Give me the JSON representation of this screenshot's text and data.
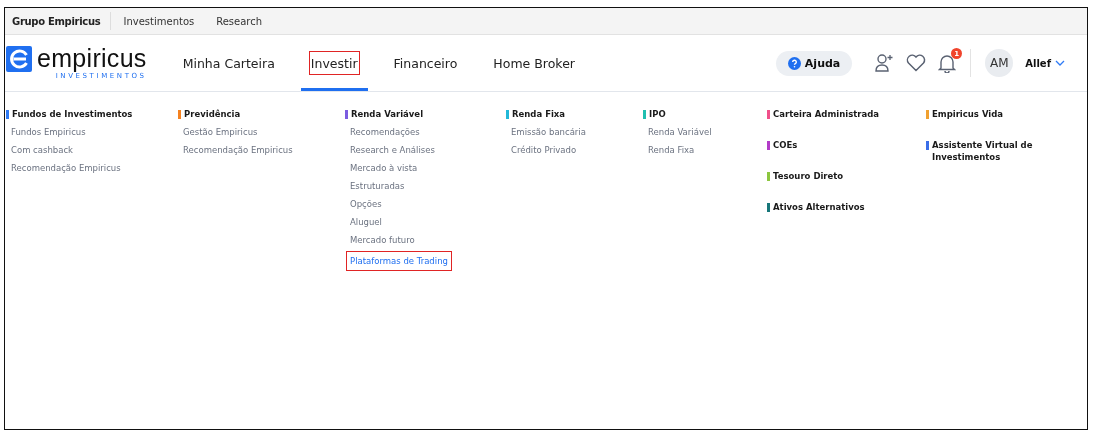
{
  "top_bar": {
    "brand": "Grupo Empiricus",
    "links": [
      "Investimentos",
      "Research"
    ]
  },
  "logo": {
    "name": "empiricus",
    "subtitle": "INVESTIMENTOS"
  },
  "nav": [
    {
      "label": "Minha Carteira",
      "selected": false,
      "highlighted": false
    },
    {
      "label": "Investir",
      "selected": true,
      "highlighted": true
    },
    {
      "label": "Financeiro",
      "selected": false,
      "highlighted": false
    },
    {
      "label": "Home Broker",
      "selected": false,
      "highlighted": false
    }
  ],
  "help_button": "Ajuda",
  "notifications_badge": "1",
  "user": {
    "initials": "AM",
    "name": "Allef"
  },
  "menu_columns": [
    {
      "groups": [
        {
          "title": "Fundos de Investimentos",
          "color": "#2f7bf5",
          "items": [
            {
              "label": "Fundos Empiricus",
              "highlighted": false
            },
            {
              "label": "Com cashback",
              "highlighted": false
            },
            {
              "label": "Recomendação Empiricus",
              "highlighted": false
            }
          ]
        }
      ]
    },
    {
      "groups": [
        {
          "title": "Previdência",
          "color": "#f58220",
          "items": [
            {
              "label": "Gestão Empiricus",
              "highlighted": false
            },
            {
              "label": "Recomendação Empiricus",
              "highlighted": false
            }
          ]
        }
      ]
    },
    {
      "groups": [
        {
          "title": "Renda Variável",
          "color": "#7b5ce0",
          "items": [
            {
              "label": "Recomendações",
              "highlighted": false
            },
            {
              "label": "Research e Análises",
              "highlighted": false
            },
            {
              "label": "Mercado à vista",
              "highlighted": false
            },
            {
              "label": "Estruturadas",
              "highlighted": false
            },
            {
              "label": "Opções",
              "highlighted": false
            },
            {
              "label": "Aluguel",
              "highlighted": false
            },
            {
              "label": "Mercado futuro",
              "highlighted": false
            },
            {
              "label": "Plataformas de Trading",
              "highlighted": true
            }
          ]
        }
      ]
    },
    {
      "groups": [
        {
          "title": "Renda Fixa",
          "color": "#22b8d8",
          "items": [
            {
              "label": "Emissão bancária",
              "highlighted": false
            },
            {
              "label": "Crédito Privado",
              "highlighted": false
            }
          ]
        }
      ]
    },
    {
      "groups": [
        {
          "title": "IPO",
          "color": "#1fbfb0",
          "items": [
            {
              "label": "Renda Variável",
              "highlighted": false
            },
            {
              "label": "Renda Fixa",
              "highlighted": false
            }
          ]
        }
      ]
    },
    {
      "groups": [
        {
          "title": "Carteira Administrada",
          "color": "#f0508a"
        },
        {
          "title": "COEs",
          "color": "#b23cc8"
        },
        {
          "title": "Tesouro Direto",
          "color": "#8cc63f"
        },
        {
          "title": "Ativos Alternativos",
          "color": "#17777a"
        }
      ]
    },
    {
      "groups": [
        {
          "title": "Empiricus Vida",
          "color": "#f0a030"
        },
        {
          "title": "Assistente Virtual de Investimentos",
          "color": "#3a6ee8"
        }
      ]
    }
  ]
}
